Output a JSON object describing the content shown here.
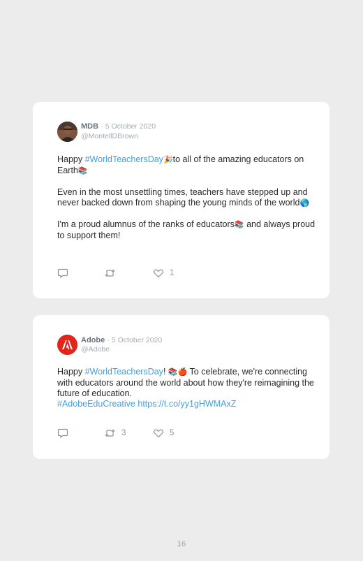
{
  "page": {
    "number": "16"
  },
  "tweets": [
    {
      "name": "MDB",
      "date": "5 October 2020",
      "handle": "@MontellDBrown",
      "avatar_icon": "person-photo",
      "p1_a": "Happy ",
      "p1_tag": "#WorldTeachersDay",
      "p1_emoji": "🎉",
      "p1_b": "to all of the amazing educators on Earth",
      "p1_emoji2": "📚",
      "p2": "Even in the most unsettling times, teachers have stepped up and never backed down from shaping the young minds of the world",
      "p2_emoji": "🌎",
      "p3_a": "I'm a proud alumnus of the ranks of educators",
      "p3_emoji": "📚",
      "p3_b": " and always proud to support them!",
      "reply_icon": "reply-icon",
      "retweet_icon": "retweet-icon",
      "retweet_count": "",
      "like_icon": "heart-icon",
      "like_count": "1"
    },
    {
      "name": "Adobe",
      "date": "5 October 2020",
      "handle": "@Adobe",
      "avatar_icon": "adobe-logo",
      "brand_color": "#e1251b",
      "p1_a": "Happy ",
      "p1_tag": "#WorldTeachersDay",
      "p1_b": "! ",
      "p1_emoji": "📚🍎",
      "p1_c": " To celebrate, we're connecting with educators around the world about how they're reimagining the future of education.",
      "p1_tag2": "#AdobeEduCreative",
      "p1_link": "https://t.co/yy1gHWMAxZ",
      "reply_icon": "reply-icon",
      "retweet_icon": "retweet-icon",
      "retweet_count": "3",
      "like_icon": "heart-icon",
      "like_count": "5"
    }
  ],
  "colors": {
    "hashtag": "#3ba3e6",
    "background": "#ececec",
    "card": "#ffffff"
  }
}
